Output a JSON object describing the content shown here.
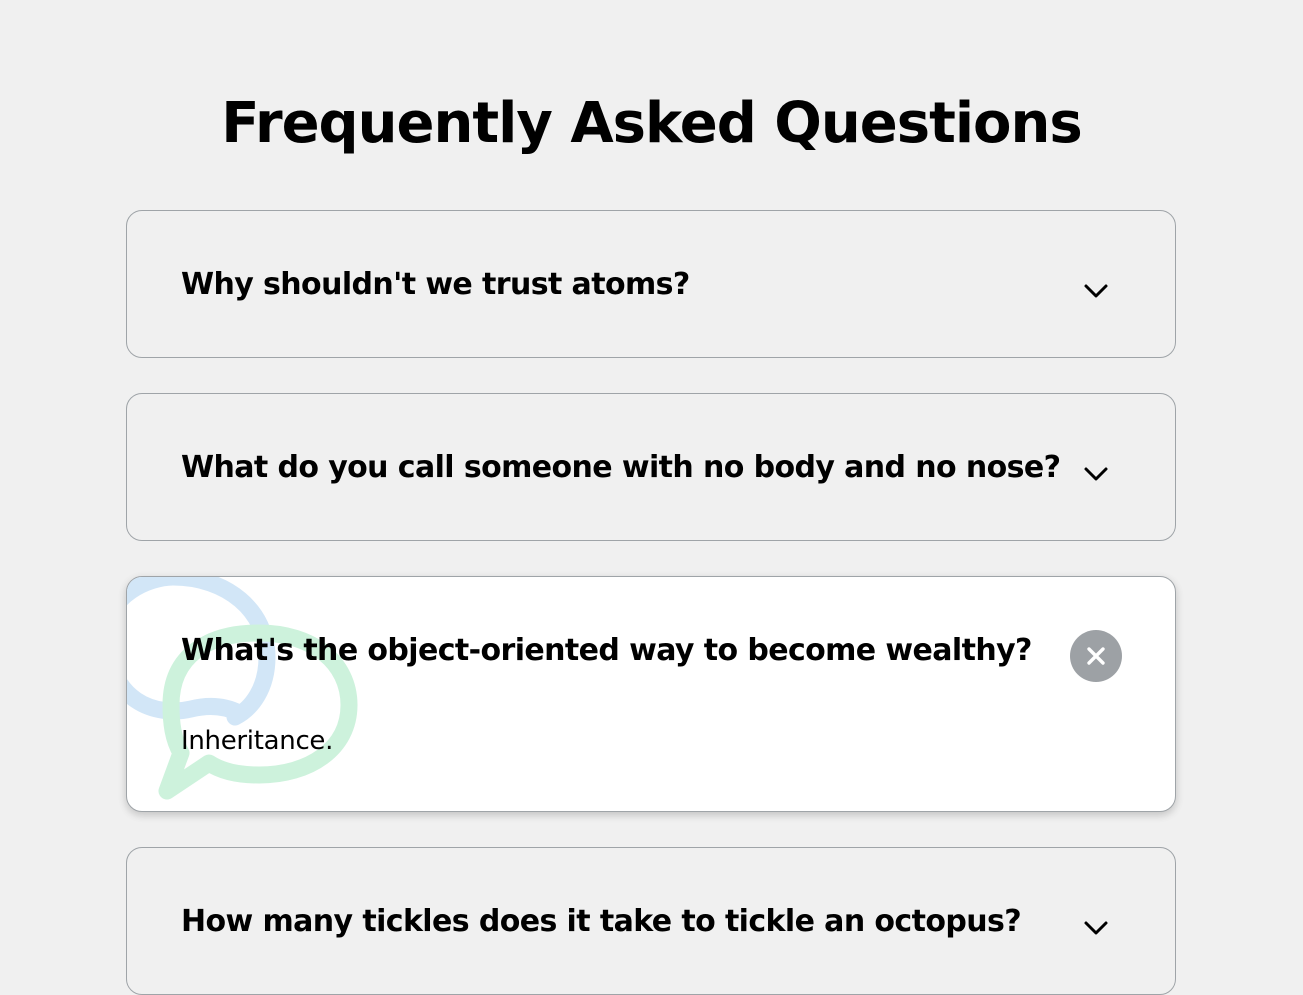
{
  "page": {
    "title": "Frequently Asked Questions"
  },
  "faqs": [
    {
      "question": "Why shouldn't we trust atoms?",
      "expanded": false,
      "toggle_icon": "chevron-down-icon"
    },
    {
      "question": "What do you call someone with no body and no nose?",
      "expanded": false,
      "toggle_icon": "chevron-down-icon"
    },
    {
      "question": "What's the object-oriented way to become wealthy?",
      "answer": "Inheritance.",
      "expanded": true,
      "toggle_icon": "close-icon",
      "decoration": "chat-bubbles-icon"
    },
    {
      "question": "How many tickles does it take to tickle an octopus?",
      "expanded": false,
      "toggle_icon": "chevron-down-icon"
    }
  ],
  "colors": {
    "background": "#f0f0f0",
    "card_border": "#9fa4a8",
    "active_card": "#ffffff",
    "close_button": "#9da1a5",
    "bubble_blue": "#d2e6f7",
    "bubble_green": "#cdf2dc"
  }
}
